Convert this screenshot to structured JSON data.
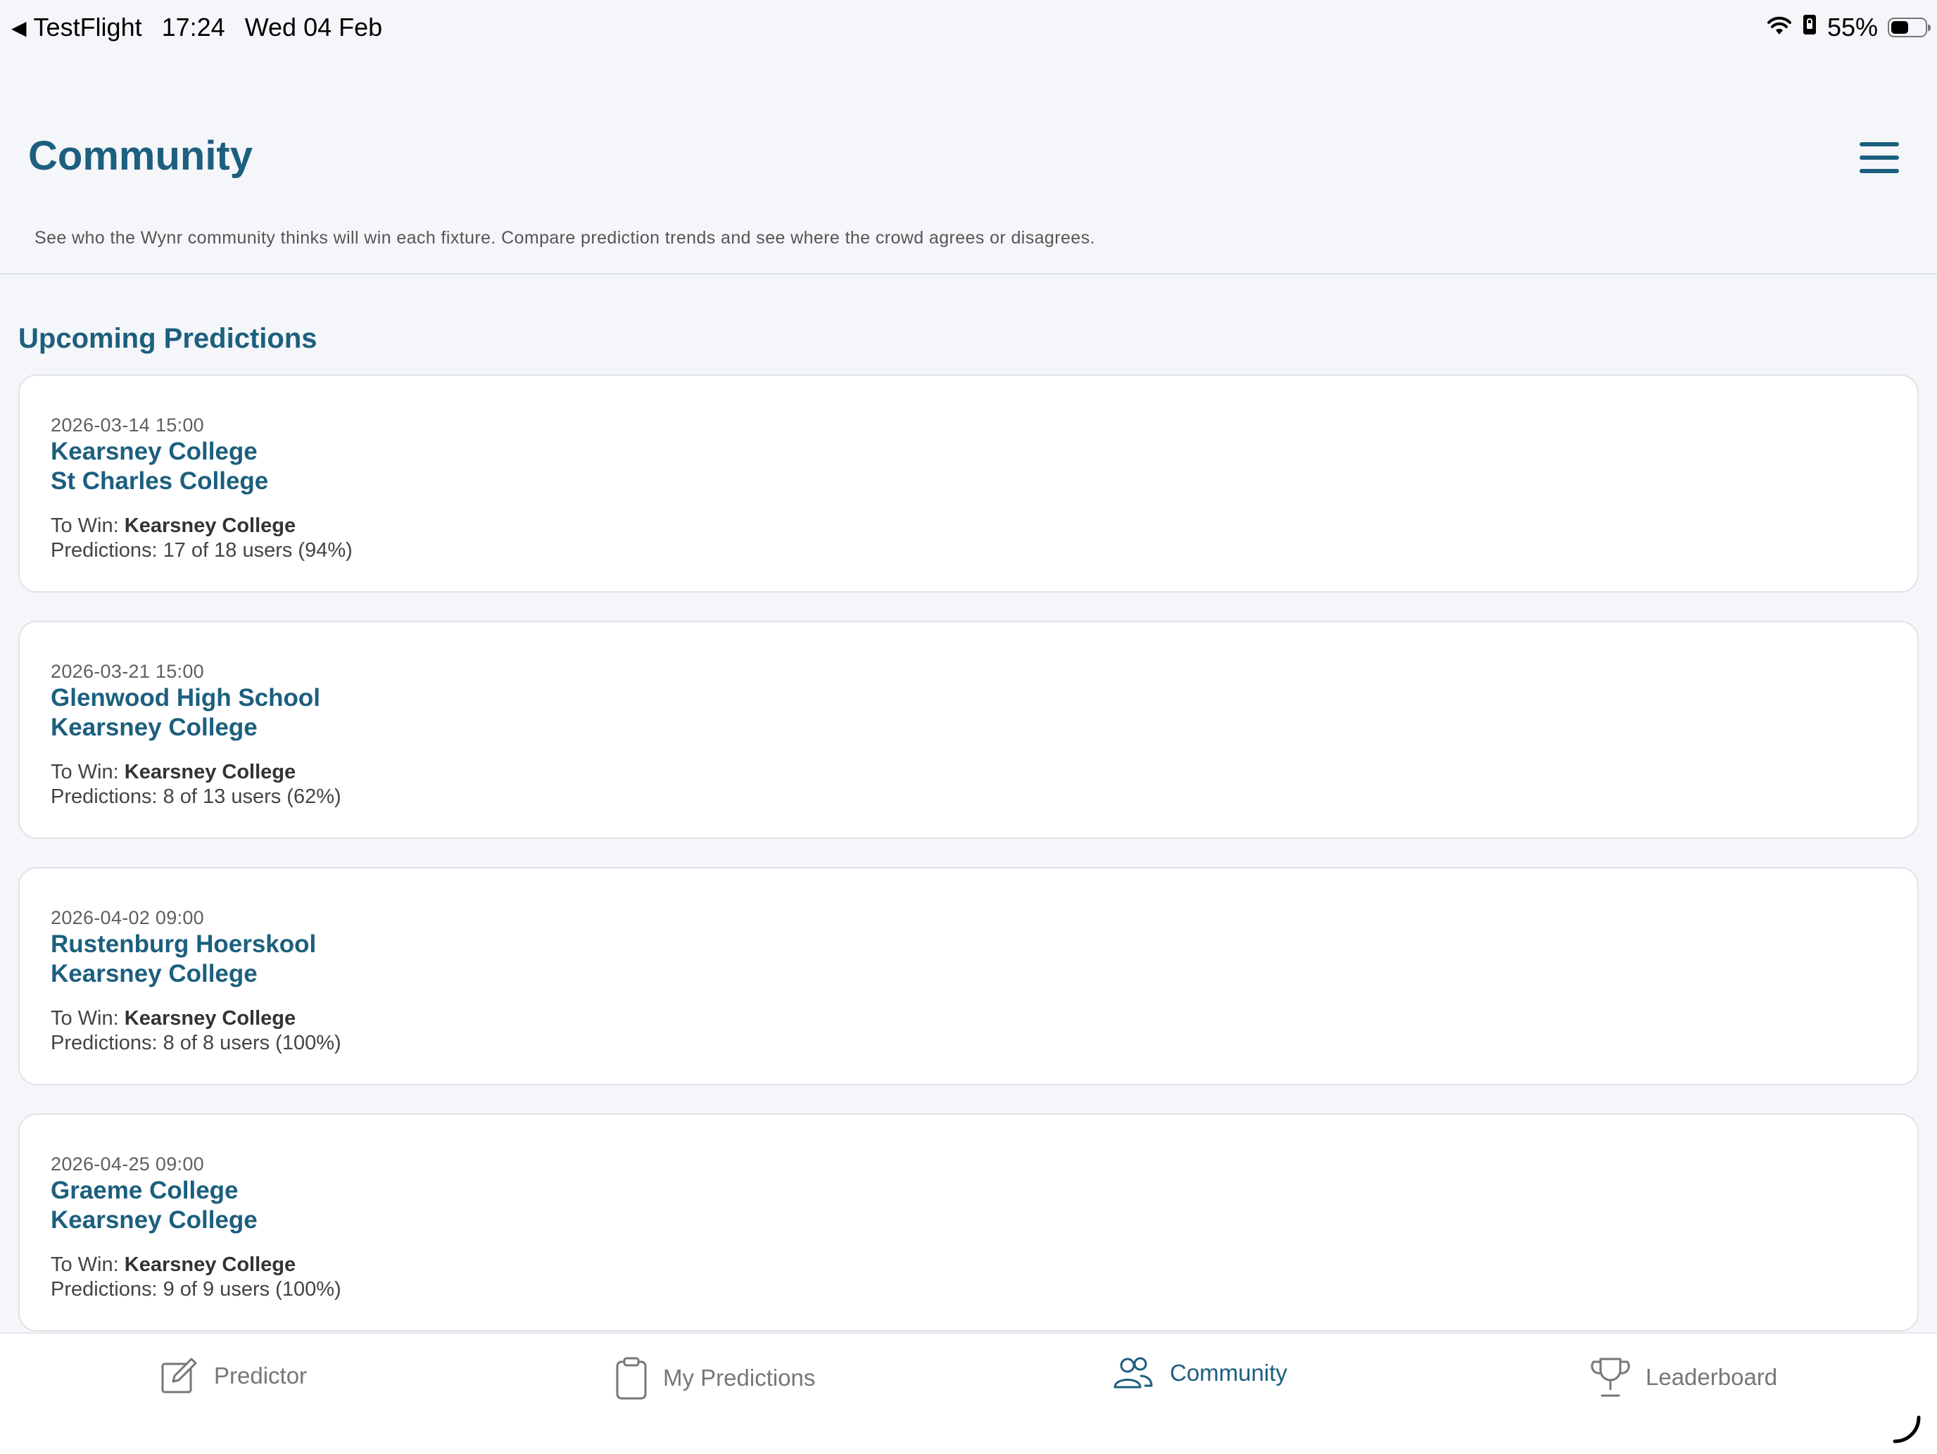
{
  "status_bar": {
    "back_label": "TestFlight",
    "time": "17:24",
    "date": "Wed 04 Feb",
    "battery_percent": "55%",
    "battery_level": 0.55,
    "icons": [
      "back-arrow-icon",
      "wifi-icon",
      "portrait-lock-icon",
      "battery-icon"
    ]
  },
  "header": {
    "title": "Community",
    "menu_icon": "hamburger-menu-icon",
    "description": "See who the Wynr community thinks will win each fixture. Compare prediction trends and see where the crowd agrees or disagrees."
  },
  "section": {
    "title": "Upcoming Predictions"
  },
  "to_win_label": "To Win:",
  "fixtures": [
    {
      "datetime": "2026-03-14 15:00",
      "team_home": "Kearsney College",
      "team_away": "St Charles College",
      "to_win": "Kearsney College",
      "predictions": "Predictions: 17 of 18 users (94%)"
    },
    {
      "datetime": "2026-03-21 15:00",
      "team_home": "Glenwood High School",
      "team_away": "Kearsney College",
      "to_win": "Kearsney College",
      "predictions": "Predictions: 8 of 13 users (62%)"
    },
    {
      "datetime": "2026-04-02 09:00",
      "team_home": "Rustenburg Hoerskool",
      "team_away": "Kearsney College",
      "to_win": "Kearsney College",
      "predictions": "Predictions: 8 of 8 users (100%)"
    },
    {
      "datetime": "2026-04-25 09:00",
      "team_home": "Graeme College",
      "team_away": "Kearsney College",
      "to_win": "Kearsney College",
      "predictions": "Predictions: 9 of 9 users (100%)"
    }
  ],
  "tabs": [
    {
      "label": "Predictor",
      "icon": "edit-icon",
      "active": false
    },
    {
      "label": "My Predictions",
      "icon": "clipboard-icon",
      "active": false
    },
    {
      "label": "Community",
      "icon": "users-icon",
      "active": true
    },
    {
      "label": "Leaderboard",
      "icon": "trophy-icon",
      "active": false
    }
  ],
  "colors": {
    "accent": "#1c5f7e",
    "background": "#f5f6f9",
    "card": "#ffffff",
    "inactive_tab": "#777777"
  }
}
